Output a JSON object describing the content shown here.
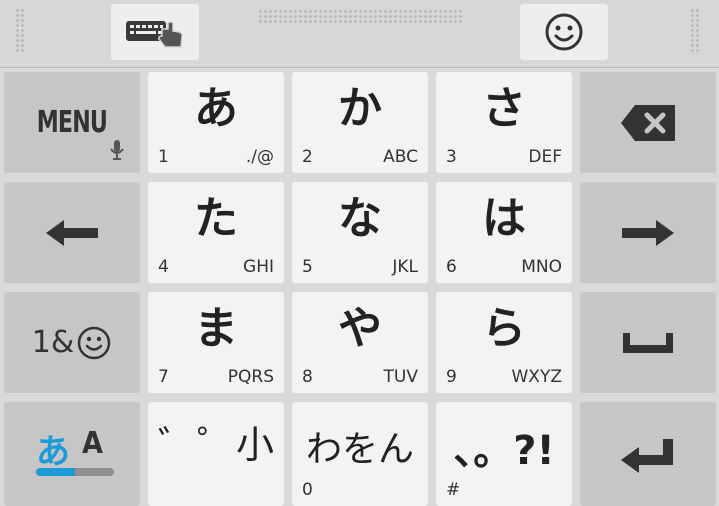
{
  "toolbar": {
    "keyboard_switch_icon": "keyboard-hand-icon",
    "emoji_icon": "smiley-icon"
  },
  "keys": {
    "menu": {
      "label": "MENU",
      "icon": "microphone-icon"
    },
    "backspace": {
      "icon": "backspace-icon"
    },
    "left": {
      "icon": "arrow-left-icon"
    },
    "right": {
      "icon": "arrow-right-icon"
    },
    "symbols": {
      "label": "1&",
      "icon": "smiley-icon"
    },
    "space": {
      "icon": "space-icon"
    },
    "enter": {
      "icon": "enter-icon"
    },
    "mode": {
      "label_kana": "あ",
      "label_alpha": "A",
      "fill": 0.5
    },
    "kana": [
      {
        "main": "あ",
        "num": "1",
        "alt": "./@"
      },
      {
        "main": "か",
        "num": "2",
        "alt": "ABC"
      },
      {
        "main": "さ",
        "num": "3",
        "alt": "DEF"
      },
      {
        "main": "た",
        "num": "4",
        "alt": "GHI"
      },
      {
        "main": "な",
        "num": "5",
        "alt": "JKL"
      },
      {
        "main": "は",
        "num": "6",
        "alt": "MNO"
      },
      {
        "main": "ま",
        "num": "7",
        "alt": "PQRS"
      },
      {
        "main": "や",
        "num": "8",
        "alt": "TUV"
      },
      {
        "main": "ら",
        "num": "9",
        "alt": "WXYZ"
      }
    ],
    "dakuten": {
      "a": "゛",
      "b": "゜",
      "c": "小"
    },
    "wa": {
      "main": "わをん",
      "num": "0"
    },
    "punct": {
      "main": "、。?!",
      "num": "#"
    }
  },
  "colors": {
    "accent": "#1a9bd8"
  }
}
